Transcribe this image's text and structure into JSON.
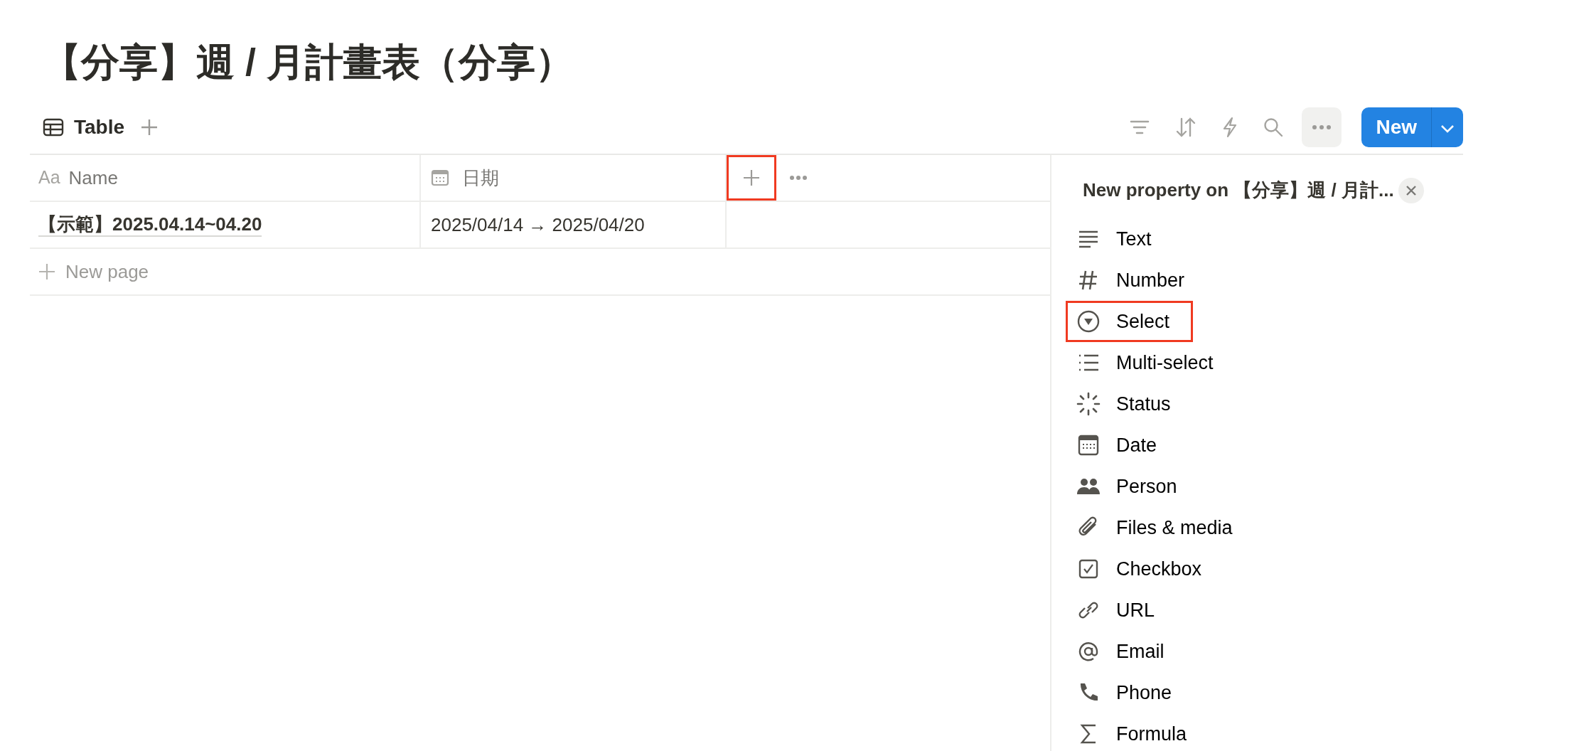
{
  "title": "【分享】週 / 月計畫表（分享）",
  "view_tabs": [
    {
      "label": "Table",
      "selected": true
    }
  ],
  "toolbar": {
    "new_button": "New"
  },
  "table": {
    "columns": [
      {
        "label": "Name",
        "type_label": "Aa"
      },
      {
        "label": "日期"
      }
    ],
    "add_column_highlighted": true,
    "rows": [
      {
        "name": "【示範】2025.04.14~04.20",
        "date": "2025/04/14 → 2025/04/20"
      }
    ],
    "new_row": "New page"
  },
  "panel": {
    "title": "New property on 【分享】週 / 月計...",
    "items": [
      {
        "label": "Text",
        "highlighted": false
      },
      {
        "label": "Number",
        "highlighted": false
      },
      {
        "label": "Select",
        "highlighted": true
      },
      {
        "label": "Multi-select",
        "highlighted": false
      },
      {
        "label": "Status",
        "highlighted": false
      },
      {
        "label": "Date",
        "highlighted": false
      },
      {
        "label": "Person",
        "highlighted": false
      },
      {
        "label": "Files & media",
        "highlighted": false
      },
      {
        "label": "Checkbox",
        "highlighted": false
      },
      {
        "label": "URL",
        "highlighted": false
      },
      {
        "label": "Email",
        "highlighted": false
      },
      {
        "label": "Phone",
        "highlighted": false
      },
      {
        "label": "Formula",
        "highlighted": false
      }
    ]
  }
}
